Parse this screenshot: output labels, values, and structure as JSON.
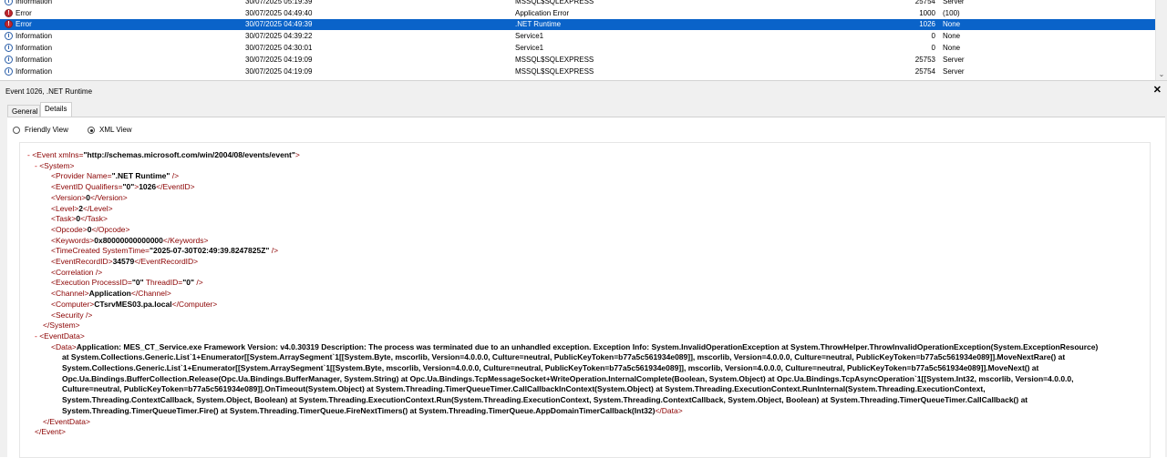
{
  "event_list": {
    "rows": [
      {
        "level": "Information",
        "level_type": "info",
        "date": "30/07/2025 05:19:39",
        "source": "MSSQL$SQLEXPRESS",
        "event_id": "25754",
        "task": "Server"
      },
      {
        "level": "Error",
        "level_type": "error",
        "date": "30/07/2025 04:49:40",
        "source": "Application Error",
        "event_id": "1000",
        "task": "(100)"
      },
      {
        "level": "Error",
        "level_type": "error",
        "date": "30/07/2025 04:49:39",
        "source": ".NET Runtime",
        "event_id": "1026",
        "task": "None",
        "selected": true
      },
      {
        "level": "Information",
        "level_type": "info",
        "date": "30/07/2025 04:39:22",
        "source": "Service1",
        "event_id": "0",
        "task": "None"
      },
      {
        "level": "Information",
        "level_type": "info",
        "date": "30/07/2025 04:30:01",
        "source": "Service1",
        "event_id": "0",
        "task": "None"
      },
      {
        "level": "Information",
        "level_type": "info",
        "date": "30/07/2025 04:19:09",
        "source": "MSSQL$SQLEXPRESS",
        "event_id": "25753",
        "task": "Server"
      },
      {
        "level": "Information",
        "level_type": "info",
        "date": "30/07/2025 04:19:09",
        "source": "MSSQL$SQLEXPRESS",
        "event_id": "25754",
        "task": "Server"
      }
    ]
  },
  "detail": {
    "title": "Event 1026, .NET Runtime",
    "close_glyph": "✕",
    "tabs": {
      "general": "General",
      "details": "Details"
    },
    "view_options": {
      "friendly": "Friendly View",
      "xml": "XML View"
    },
    "xml": {
      "event_open_tag": "<Event xmlns=",
      "event_xmlns": "\"http://schemas.microsoft.com/win/2004/08/events/event\"",
      "event_open_close": ">",
      "system_open": "<System>",
      "provider_prefix": "<Provider Name=",
      "provider_name": "\".NET Runtime\"",
      "provider_suffix": " />",
      "eventid_open": "<EventID Qualifiers=",
      "eventid_qualifiers": "\"0\"",
      "eventid_gt": ">",
      "eventid_value": "1026",
      "eventid_close": "</EventID>",
      "version_open": "<Version>",
      "version_value": "0",
      "version_close": "</Version>",
      "level_open": "<Level>",
      "level_value": "2",
      "level_close": "</Level>",
      "task_open": "<Task>",
      "task_value": "0",
      "task_close": "</Task>",
      "opcode_open": "<Opcode>",
      "opcode_value": "0",
      "opcode_close": "</Opcode>",
      "keywords_open": "<Keywords>",
      "keywords_value": "0x80000000000000",
      "keywords_close": "</Keywords>",
      "timecreated_prefix": "<TimeCreated SystemTime=",
      "timecreated_value": "\"2025-07-30T02:49:39.8247825Z\"",
      "timecreated_suffix": " />",
      "recordid_open": "<EventRecordID>",
      "recordid_value": "34579",
      "recordid_close": "</EventRecordID>",
      "correlation": "<Correlation />",
      "execution_prefix": "<Execution ProcessID=",
      "execution_pid": "\"0\"",
      "execution_tid_attr": " ThreadID=",
      "execution_tid": "\"0\"",
      "execution_suffix": " />",
      "channel_open": "<Channel>",
      "channel_value": "Application",
      "channel_close": "</Channel>",
      "computer_open": "<Computer>",
      "computer_value": "CTsrvMES03.pa.local",
      "computer_close": "</Computer>",
      "security": "<Security />",
      "system_close": "</System>",
      "eventdata_open": "<EventData>",
      "data_open": "<Data>",
      "data_text": "Application: MES_CT_Service.exe Framework Version: v4.0.30319 Description: The process was terminated due to an unhandled exception. Exception Info: System.InvalidOperationException at System.ThrowHelper.ThrowInvalidOperationException(System.ExceptionResource) at System.Collections.Generic.List`1+Enumerator[[System.ArraySegment`1[[System.Byte, mscorlib, Version=4.0.0.0, Culture=neutral, PublicKeyToken=b77a5c561934e089]], mscorlib, Version=4.0.0.0, Culture=neutral, PublicKeyToken=b77a5c561934e089]].MoveNextRare() at System.Collections.Generic.List`1+Enumerator[[System.ArraySegment`1[[System.Byte, mscorlib, Version=4.0.0.0, Culture=neutral, PublicKeyToken=b77a5c561934e089]], mscorlib, Version=4.0.0.0, Culture=neutral, PublicKeyToken=b77a5c561934e089]].MoveNext() at Opc.Ua.Bindings.BufferCollection.Release(Opc.Ua.Bindings.BufferManager, System.String) at Opc.Ua.Bindings.TcpMessageSocket+WriteOperation.InternalComplete(Boolean, System.Object) at Opc.Ua.Bindings.TcpAsyncOperation`1[[System.Int32, mscorlib, Version=4.0.0.0, Culture=neutral, PublicKeyToken=b77a5c561934e089]].OnTimeout(System.Object) at System.Threading.TimerQueueTimer.CallCallbackInContext(System.Object) at System.Threading.ExecutionContext.RunInternal(System.Threading.ExecutionContext, System.Threading.ContextCallback, System.Object, Boolean) at System.Threading.ExecutionContext.Run(System.Threading.ExecutionContext, System.Threading.ContextCallback, System.Object, Boolean) at System.Threading.TimerQueueTimer.CallCallback() at System.Threading.TimerQueueTimer.Fire() at System.Threading.TimerQueue.FireNextTimers() at System.Threading.TimerQueue.AppDomainTimerCallback(Int32)",
      "data_close": "</Data>",
      "eventdata_close": "</EventData>",
      "event_close": "</Event>",
      "collapse_marker": "-"
    }
  },
  "colors": {
    "selection": "#0a63c9",
    "xml_markup": "#8b0000",
    "collapse_marker": "#c00000",
    "error_icon": "#c0262d",
    "info_icon": "#2a5ea8"
  }
}
